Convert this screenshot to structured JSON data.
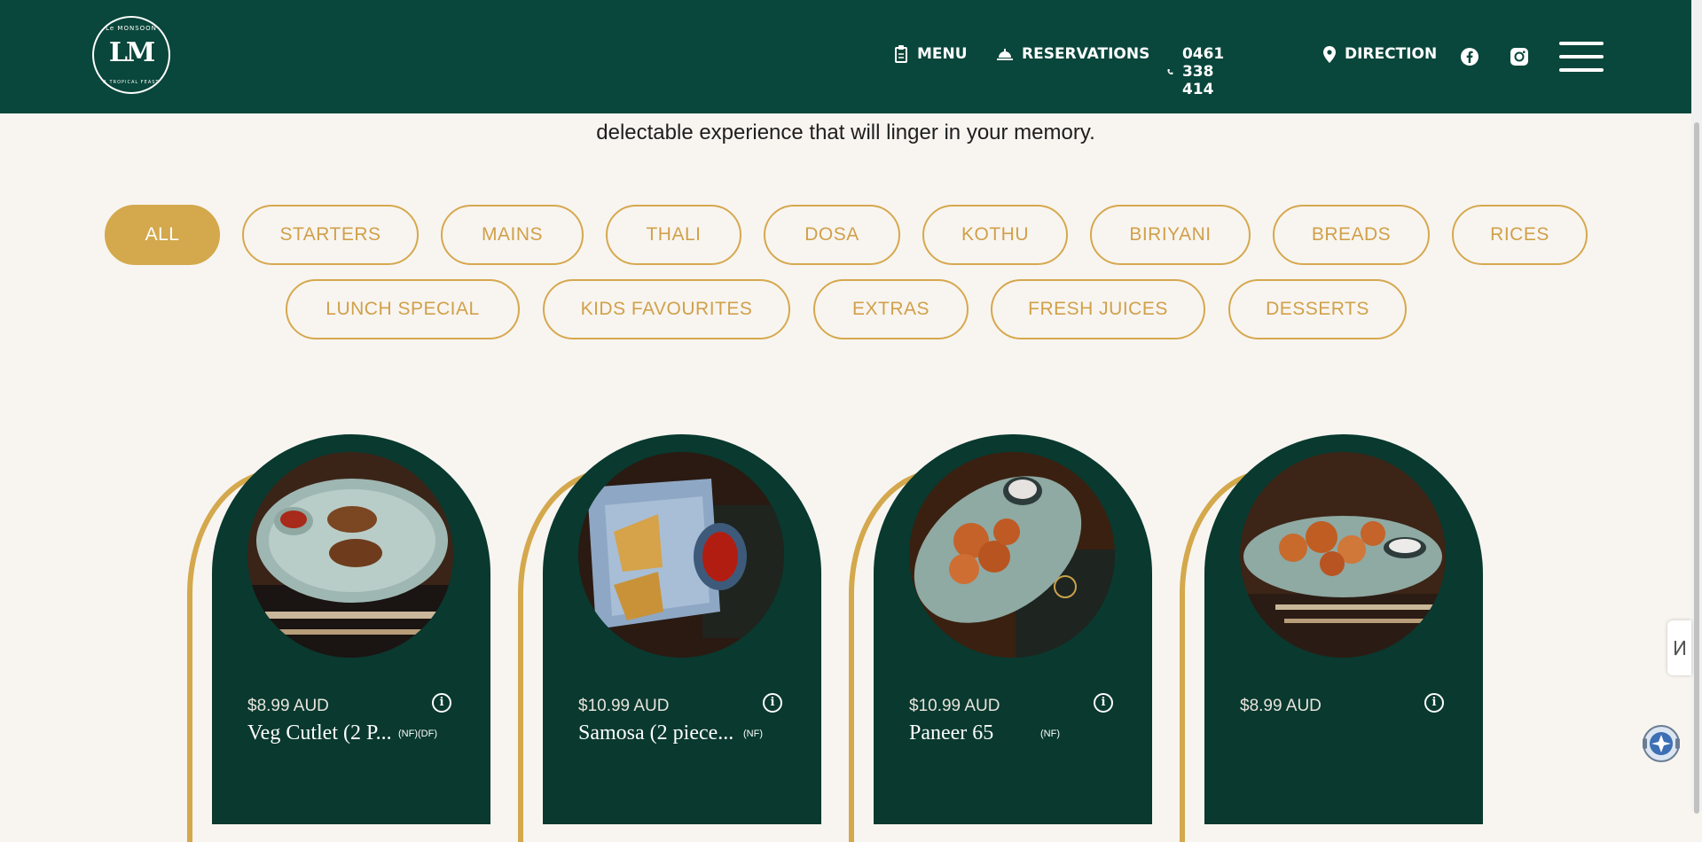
{
  "header": {
    "logo_top": "Le MONSOON",
    "logo_mark": "LM",
    "logo_bottom": "A TROPICAL FEAST",
    "nav": {
      "menu": "MENU",
      "reservations": "RESERVATIONS",
      "phone": "0461 338 414",
      "direction": "DIRECTION"
    }
  },
  "intro": {
    "line": "delectable experience that will linger in your memory."
  },
  "filters": {
    "all": "ALL",
    "starters": "STARTERS",
    "mains": "MAINS",
    "thali": "THALI",
    "dosa": "DOSA",
    "kothu": "KOTHU",
    "biriyani": "BIRIYANI",
    "breads": "BREADS",
    "rices": "RICES",
    "lunch_special": "LUNCH SPECIAL",
    "kids_favourites": "KIDS FAVOURITES",
    "extras": "EXTRAS",
    "fresh_juices": "FRESH JUICES",
    "desserts": "DESSERTS"
  },
  "cards": [
    {
      "price": "$8.99 AUD",
      "name": "Veg Cutlet (2 P...",
      "tag": "(NF)(DF)"
    },
    {
      "price": "$10.99 AUD",
      "name": "Samosa (2 piece...",
      "tag": "(NF)"
    },
    {
      "price": "$10.99 AUD",
      "name": "Paneer 65",
      "tag": "(NF)"
    },
    {
      "price": "$8.99 AUD",
      "name": "",
      "tag": ""
    }
  ],
  "info_glyph": "i",
  "colors": {
    "header_bg": "#09463b",
    "card_bg": "#09392f",
    "accent_gold": "#d4a84c",
    "page_bg": "#f8f5f0"
  }
}
